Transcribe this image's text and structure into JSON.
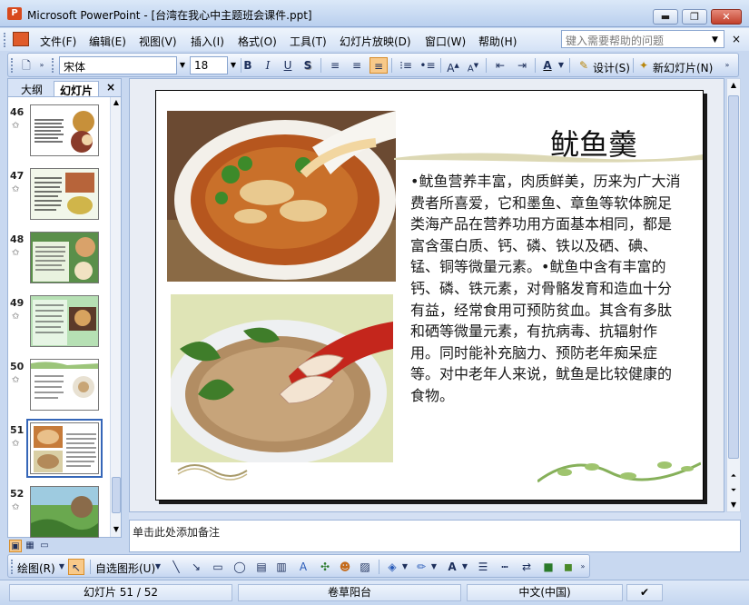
{
  "window": {
    "title": "Microsoft PowerPoint - [台湾在我心中主题班会课件.ppt]",
    "minimize_icon": "minimize-icon",
    "restore_icon": "restore-icon",
    "close_icon": "close-icon"
  },
  "menubar": {
    "items": [
      "文件(F)",
      "编辑(E)",
      "视图(V)",
      "插入(I)",
      "格式(O)",
      "工具(T)",
      "幻灯片放映(D)",
      "窗口(W)",
      "帮助(H)"
    ],
    "help_placeholder": "键入需要帮助的问题"
  },
  "format_toolbar": {
    "font_name": "宋体",
    "font_size": "18",
    "bold": "B",
    "italic": "I",
    "underline": "U",
    "shadow": "S",
    "design_label": "设计(S)",
    "new_slide_label": "新幻灯片(N)",
    "accent_active": "#f8c989"
  },
  "left_pane": {
    "tab_outline": "大纲",
    "tab_slides": "幻灯片",
    "close": "×",
    "thumbnails": [
      {
        "number": "46"
      },
      {
        "number": "47"
      },
      {
        "number": "48"
      },
      {
        "number": "49"
      },
      {
        "number": "50"
      },
      {
        "number": "51"
      },
      {
        "number": "52"
      }
    ],
    "selected_slide": "51"
  },
  "slide": {
    "title": "鱿鱼羹",
    "body": "•鱿鱼营养丰富，肉质鲜美，历来为广大消费者所喜爱，它和墨鱼、章鱼等软体腕足类海产品在营养功用方面基本相同，都是富含蛋白质、钙、磷、铁以及硒、碘、锰、铜等微量元素。•鱿鱼中含有丰富的钙、磷、铁元素，对骨骼发育和造血十分有益，经常食用可预防贫血。其含有多肽和硒等微量元素，有抗病毒、抗辐射作用。同时能补充脑力、预防老年痴呆症等。对中老年人来说，鱿鱼是比较健康的食物。"
  },
  "notes": {
    "placeholder": "单击此处添加备注"
  },
  "draw_toolbar": {
    "draw_label": "绘图(R)",
    "autoshapes_label": "自选图形(U)"
  },
  "statusbar": {
    "slide_position": "幻灯片 51 / 52",
    "design_name": "卷草阳台",
    "language": "中文(中国)"
  }
}
